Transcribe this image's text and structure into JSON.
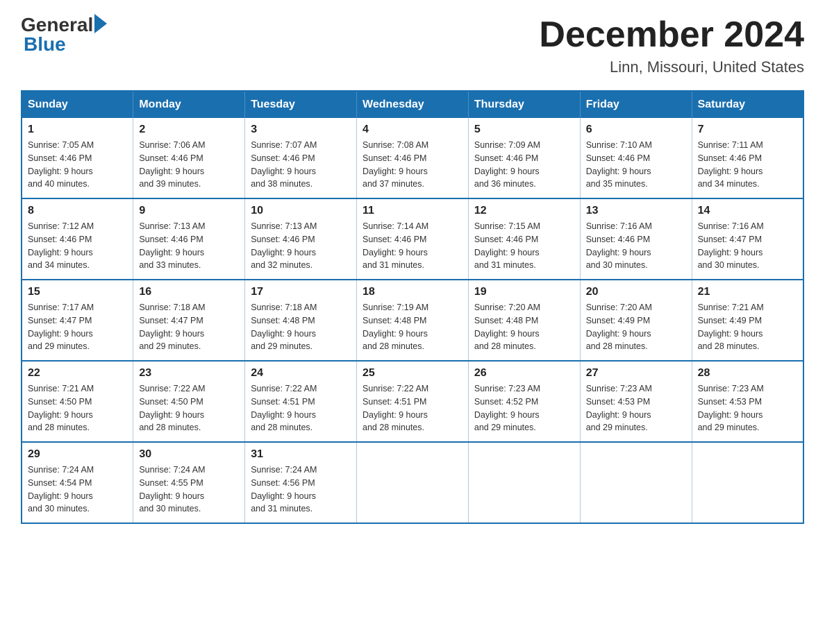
{
  "logo": {
    "general": "General",
    "blue": "Blue"
  },
  "header": {
    "month": "December 2024",
    "location": "Linn, Missouri, United States"
  },
  "weekdays": [
    "Sunday",
    "Monday",
    "Tuesday",
    "Wednesday",
    "Thursday",
    "Friday",
    "Saturday"
  ],
  "weeks": [
    [
      {
        "num": "1",
        "sunrise": "7:05 AM",
        "sunset": "4:46 PM",
        "daylight": "9 hours and 40 minutes."
      },
      {
        "num": "2",
        "sunrise": "7:06 AM",
        "sunset": "4:46 PM",
        "daylight": "9 hours and 39 minutes."
      },
      {
        "num": "3",
        "sunrise": "7:07 AM",
        "sunset": "4:46 PM",
        "daylight": "9 hours and 38 minutes."
      },
      {
        "num": "4",
        "sunrise": "7:08 AM",
        "sunset": "4:46 PM",
        "daylight": "9 hours and 37 minutes."
      },
      {
        "num": "5",
        "sunrise": "7:09 AM",
        "sunset": "4:46 PM",
        "daylight": "9 hours and 36 minutes."
      },
      {
        "num": "6",
        "sunrise": "7:10 AM",
        "sunset": "4:46 PM",
        "daylight": "9 hours and 35 minutes."
      },
      {
        "num": "7",
        "sunrise": "7:11 AM",
        "sunset": "4:46 PM",
        "daylight": "9 hours and 34 minutes."
      }
    ],
    [
      {
        "num": "8",
        "sunrise": "7:12 AM",
        "sunset": "4:46 PM",
        "daylight": "9 hours and 34 minutes."
      },
      {
        "num": "9",
        "sunrise": "7:13 AM",
        "sunset": "4:46 PM",
        "daylight": "9 hours and 33 minutes."
      },
      {
        "num": "10",
        "sunrise": "7:13 AM",
        "sunset": "4:46 PM",
        "daylight": "9 hours and 32 minutes."
      },
      {
        "num": "11",
        "sunrise": "7:14 AM",
        "sunset": "4:46 PM",
        "daylight": "9 hours and 31 minutes."
      },
      {
        "num": "12",
        "sunrise": "7:15 AM",
        "sunset": "4:46 PM",
        "daylight": "9 hours and 31 minutes."
      },
      {
        "num": "13",
        "sunrise": "7:16 AM",
        "sunset": "4:46 PM",
        "daylight": "9 hours and 30 minutes."
      },
      {
        "num": "14",
        "sunrise": "7:16 AM",
        "sunset": "4:47 PM",
        "daylight": "9 hours and 30 minutes."
      }
    ],
    [
      {
        "num": "15",
        "sunrise": "7:17 AM",
        "sunset": "4:47 PM",
        "daylight": "9 hours and 29 minutes."
      },
      {
        "num": "16",
        "sunrise": "7:18 AM",
        "sunset": "4:47 PM",
        "daylight": "9 hours and 29 minutes."
      },
      {
        "num": "17",
        "sunrise": "7:18 AM",
        "sunset": "4:48 PM",
        "daylight": "9 hours and 29 minutes."
      },
      {
        "num": "18",
        "sunrise": "7:19 AM",
        "sunset": "4:48 PM",
        "daylight": "9 hours and 28 minutes."
      },
      {
        "num": "19",
        "sunrise": "7:20 AM",
        "sunset": "4:48 PM",
        "daylight": "9 hours and 28 minutes."
      },
      {
        "num": "20",
        "sunrise": "7:20 AM",
        "sunset": "4:49 PM",
        "daylight": "9 hours and 28 minutes."
      },
      {
        "num": "21",
        "sunrise": "7:21 AM",
        "sunset": "4:49 PM",
        "daylight": "9 hours and 28 minutes."
      }
    ],
    [
      {
        "num": "22",
        "sunrise": "7:21 AM",
        "sunset": "4:50 PM",
        "daylight": "9 hours and 28 minutes."
      },
      {
        "num": "23",
        "sunrise": "7:22 AM",
        "sunset": "4:50 PM",
        "daylight": "9 hours and 28 minutes."
      },
      {
        "num": "24",
        "sunrise": "7:22 AM",
        "sunset": "4:51 PM",
        "daylight": "9 hours and 28 minutes."
      },
      {
        "num": "25",
        "sunrise": "7:22 AM",
        "sunset": "4:51 PM",
        "daylight": "9 hours and 28 minutes."
      },
      {
        "num": "26",
        "sunrise": "7:23 AM",
        "sunset": "4:52 PM",
        "daylight": "9 hours and 29 minutes."
      },
      {
        "num": "27",
        "sunrise": "7:23 AM",
        "sunset": "4:53 PM",
        "daylight": "9 hours and 29 minutes."
      },
      {
        "num": "28",
        "sunrise": "7:23 AM",
        "sunset": "4:53 PM",
        "daylight": "9 hours and 29 minutes."
      }
    ],
    [
      {
        "num": "29",
        "sunrise": "7:24 AM",
        "sunset": "4:54 PM",
        "daylight": "9 hours and 30 minutes."
      },
      {
        "num": "30",
        "sunrise": "7:24 AM",
        "sunset": "4:55 PM",
        "daylight": "9 hours and 30 minutes."
      },
      {
        "num": "31",
        "sunrise": "7:24 AM",
        "sunset": "4:56 PM",
        "daylight": "9 hours and 31 minutes."
      },
      null,
      null,
      null,
      null
    ]
  ]
}
